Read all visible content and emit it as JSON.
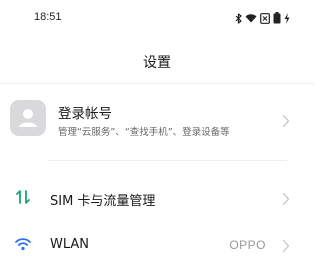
{
  "status_bar": {
    "time": "18:51",
    "icons": [
      "bluetooth-icon",
      "wifi-icon",
      "sim-off-icon",
      "battery-icon",
      "charging-icon"
    ]
  },
  "header": {
    "title": "设置"
  },
  "account": {
    "title": "登录帐号",
    "subtitle": "管理“云服务”、“查找手机”、登录设备等",
    "icon": "avatar-placeholder-icon"
  },
  "settings": [
    {
      "label": "SIM 卡与流量管理",
      "value": "",
      "icon": "data-transfer-icon"
    },
    {
      "label": "WLAN",
      "value": "OPPO",
      "icon": "wifi-icon"
    }
  ],
  "colors": {
    "accent": "#1aa37a",
    "wifi_blue": "#2b6ff0",
    "avatar_bg": "#d9d9dc",
    "chevron": "#c4c4c4"
  }
}
